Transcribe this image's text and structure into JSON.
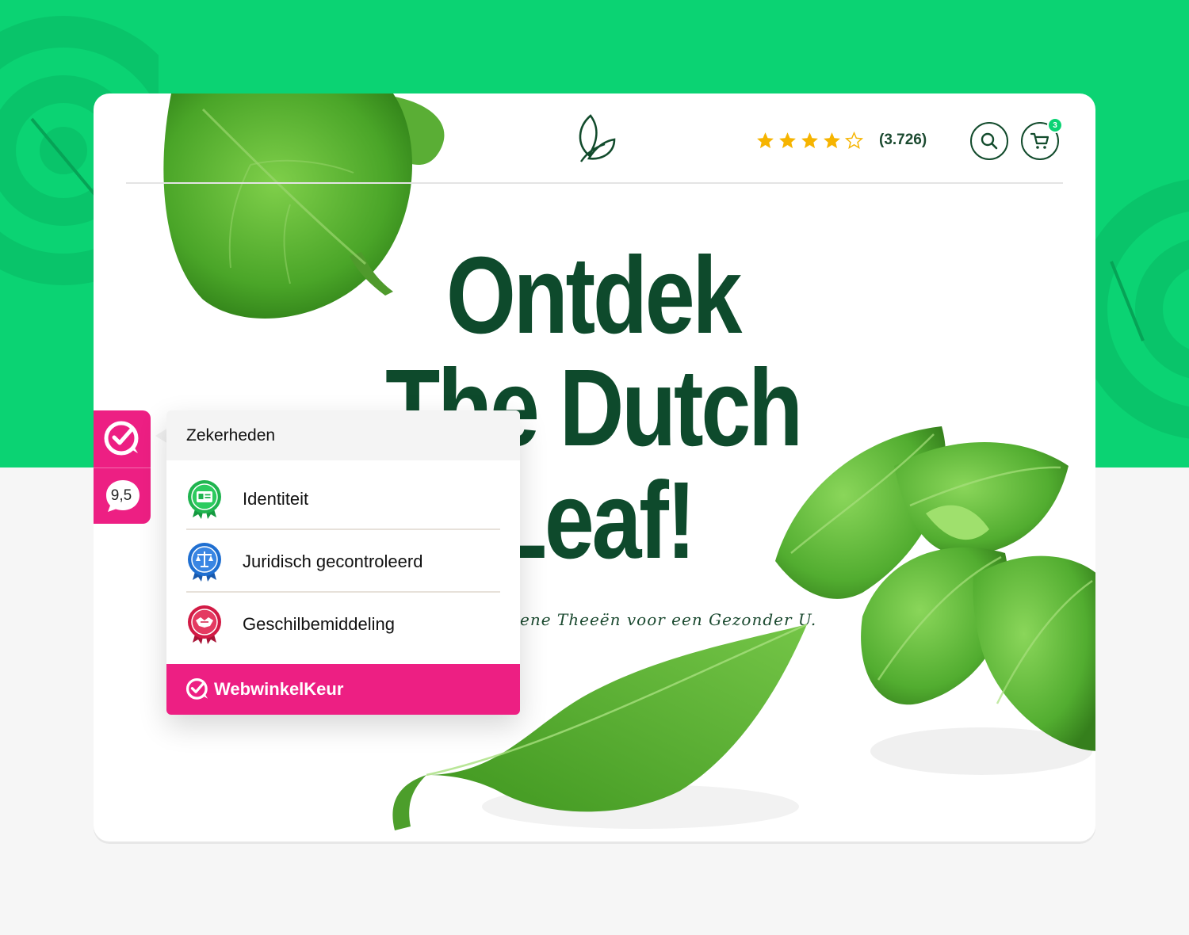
{
  "header": {
    "logo_icon": "leaf-logo-icon",
    "rating": {
      "value": 4,
      "max": 5,
      "count_label": "(3.726)"
    },
    "search_icon": "search-icon",
    "cart_icon": "cart-icon",
    "cart_badge": "3"
  },
  "hero": {
    "title_lines": [
      "Ontdek",
      "The Dutch",
      "Leaf!"
    ],
    "subtitle": "ene Theeën voor een Gezonder U."
  },
  "trust_widget": {
    "score": "9,5",
    "panel_title": "Zekerheden",
    "items": [
      {
        "label": "Identiteit",
        "icon": "identity-badge-icon",
        "color": "#1fb44f"
      },
      {
        "label": "Juridisch gecontroleerd",
        "icon": "legal-badge-icon",
        "color": "#1f6fd1"
      },
      {
        "label": "Geschilbemiddeling",
        "icon": "mediation-badge-icon",
        "color": "#d21a45"
      }
    ],
    "brand": "WebwinkelKeur"
  },
  "colors": {
    "brand_green": "#0bd373",
    "text_dark_green": "#0e4a2c",
    "brand_pink": "#ed1f83",
    "star_gold": "#f6b400"
  }
}
